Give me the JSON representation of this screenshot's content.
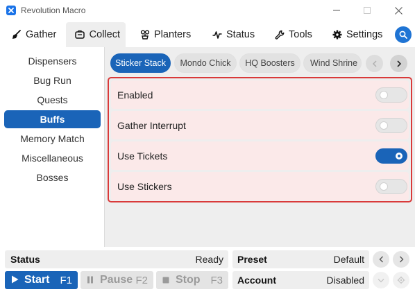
{
  "window": {
    "title": "Revolution Macro"
  },
  "tabs": [
    {
      "label": "Gather",
      "icon": "broom-icon"
    },
    {
      "label": "Collect",
      "icon": "backpack-icon"
    },
    {
      "label": "Planters",
      "icon": "planter-icon"
    },
    {
      "label": "Status",
      "icon": "pulse-icon"
    },
    {
      "label": "Tools",
      "icon": "wrench-icon"
    },
    {
      "label": "Settings",
      "icon": "gear-icon"
    }
  ],
  "active_tab": "Collect",
  "sidebar": {
    "items": [
      {
        "label": "Dispensers"
      },
      {
        "label": "Bug Run"
      },
      {
        "label": "Quests"
      },
      {
        "label": "Buffs"
      },
      {
        "label": "Memory Match"
      },
      {
        "label": "Miscellaneous"
      },
      {
        "label": "Bosses"
      }
    ],
    "active": "Buffs"
  },
  "subtabs": {
    "items": [
      {
        "label": "Sticker Stack"
      },
      {
        "label": "Mondo Chick"
      },
      {
        "label": "HQ Boosters"
      },
      {
        "label": "Wind Shrine"
      }
    ],
    "active": "Sticker Stack"
  },
  "options": [
    {
      "label": "Enabled",
      "on": false
    },
    {
      "label": "Gather Interrupt",
      "on": false
    },
    {
      "label": "Use Tickets",
      "on": true
    },
    {
      "label": "Use Stickers",
      "on": false
    }
  ],
  "bottom": {
    "status_label": "Status",
    "status_value": "Ready",
    "preset_label": "Preset",
    "preset_value": "Default",
    "account_label": "Account",
    "account_value": "Disabled",
    "start": {
      "label": "Start",
      "key": "F1"
    },
    "pause": {
      "label": "Pause",
      "key": "F2"
    },
    "stop": {
      "label": "Stop",
      "key": "F3"
    }
  },
  "colors": {
    "accent": "#1a64b8",
    "highlight_border": "#d93a3a",
    "option_bg": "#fbe9e9"
  }
}
